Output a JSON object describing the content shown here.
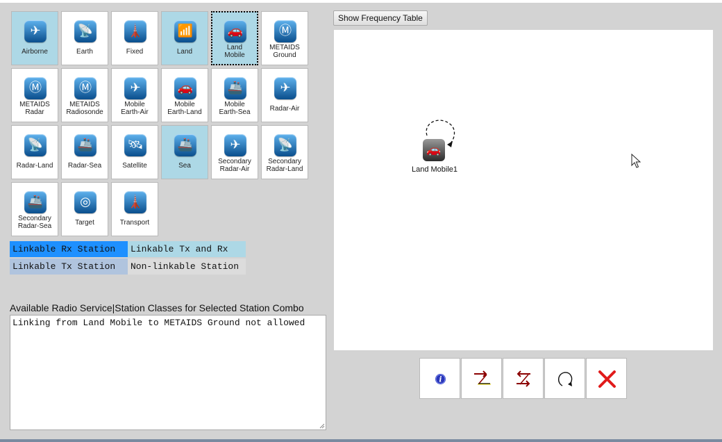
{
  "station_types": [
    {
      "label": "Airborne",
      "icon": "airplane-icon",
      "glyph": "✈",
      "selected": true,
      "focused": false
    },
    {
      "label": "Earth",
      "icon": "satellite-dish-icon",
      "glyph": "📡",
      "selected": false,
      "focused": false
    },
    {
      "label": "Fixed",
      "icon": "antenna-tower-icon",
      "glyph": "🗼",
      "selected": false,
      "focused": false
    },
    {
      "label": "Land",
      "icon": "land-antenna-icon",
      "glyph": "📶",
      "selected": true,
      "focused": false
    },
    {
      "label": "Land Mobile",
      "icon": "car-icon",
      "glyph": "🚗",
      "selected": true,
      "focused": true
    },
    {
      "label": "METAIDS Ground",
      "icon": "metaids-ground-icon",
      "glyph": "Ⓜ",
      "selected": false,
      "focused": false
    },
    {
      "label": "METAIDS Radar",
      "icon": "metaids-radar-icon",
      "glyph": "Ⓜ",
      "selected": false,
      "focused": false
    },
    {
      "label": "METAIDS Radiosonde",
      "icon": "radiosonde-balloon-icon",
      "glyph": "Ⓜ",
      "selected": false,
      "focused": false
    },
    {
      "label": "Mobile Earth-Air",
      "icon": "mobile-earth-air-icon",
      "glyph": "✈",
      "selected": false,
      "focused": false
    },
    {
      "label": "Mobile Earth-Land",
      "icon": "mobile-earth-land-icon",
      "glyph": "🚗",
      "selected": false,
      "focused": false
    },
    {
      "label": "Mobile Earth-Sea",
      "icon": "mobile-earth-sea-icon",
      "glyph": "🚢",
      "selected": false,
      "focused": false
    },
    {
      "label": "Radar-Air",
      "icon": "radar-air-icon",
      "glyph": "✈",
      "selected": false,
      "focused": false
    },
    {
      "label": "Radar-Land",
      "icon": "radar-land-icon",
      "glyph": "📡",
      "selected": false,
      "focused": false
    },
    {
      "label": "Radar-Sea",
      "icon": "radar-sea-icon",
      "glyph": "🚢",
      "selected": false,
      "focused": false
    },
    {
      "label": "Satellite",
      "icon": "satellite-icon",
      "glyph": "🛰",
      "selected": false,
      "focused": false
    },
    {
      "label": "Sea",
      "icon": "ship-icon",
      "glyph": "🚢",
      "selected": true,
      "focused": false
    },
    {
      "label": "Secondary Radar-Air",
      "icon": "secondary-radar-air-icon",
      "glyph": "✈",
      "selected": false,
      "focused": false
    },
    {
      "label": "Secondary Radar-Land",
      "icon": "secondary-radar-land-icon",
      "glyph": "📡",
      "selected": false,
      "focused": false
    },
    {
      "label": "Secondary Radar-Sea",
      "icon": "secondary-radar-sea-icon",
      "glyph": "🚢",
      "selected": false,
      "focused": false
    },
    {
      "label": "Target",
      "icon": "target-icon",
      "glyph": "◎",
      "selected": false,
      "focused": false
    },
    {
      "label": "Transport",
      "icon": "transport-antenna-icon",
      "glyph": "🗼",
      "selected": false,
      "focused": false
    }
  ],
  "legend": {
    "linkable_rx": {
      "label": "Linkable Rx Station",
      "color": "#1e90ff"
    },
    "linkable_tx_rx": {
      "label": "Linkable Tx and Rx",
      "color": "#add8e6"
    },
    "linkable_tx": {
      "label": "Linkable Tx Station",
      "color": "#b0c4de"
    },
    "non_linkable": {
      "label": "Non-linkable Station",
      "color": "#dcdcdc"
    }
  },
  "info": {
    "title": "Available Radio Service|Station Classes for Selected Station Combo",
    "message": "Linking from Land Mobile to METAIDS Ground not allowed"
  },
  "toolbar": {
    "frequency_table_label": "Show Frequency Table"
  },
  "canvas": {
    "node_label": "Land Mobile1",
    "node_icon": "car-icon"
  },
  "actions": [
    {
      "name": "info-button",
      "icon": "info-icon"
    },
    {
      "name": "link-forward-button",
      "icon": "link-forward-icon"
    },
    {
      "name": "link-reverse-button",
      "icon": "link-reverse-icon"
    },
    {
      "name": "self-link-button",
      "icon": "loop-arrow-icon"
    },
    {
      "name": "delete-button",
      "icon": "red-x-icon"
    }
  ]
}
